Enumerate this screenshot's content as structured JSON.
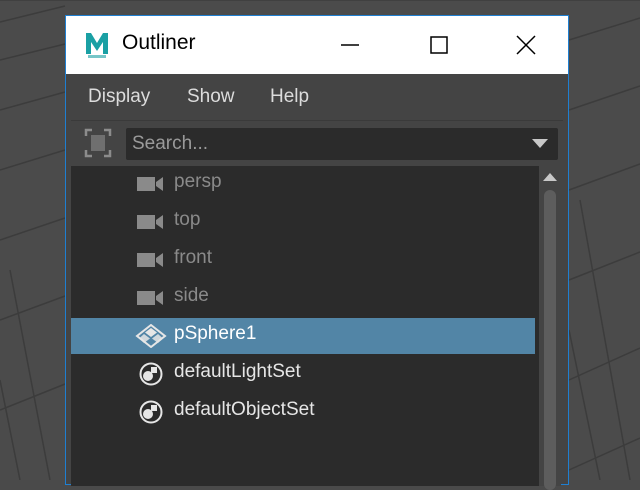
{
  "window": {
    "title": "Outliner",
    "border_color": "#1f7fd1"
  },
  "menu": {
    "items": [
      {
        "label": "Display"
      },
      {
        "label": "Show"
      },
      {
        "label": "Help"
      }
    ]
  },
  "search": {
    "placeholder": "Search..."
  },
  "outliner": {
    "items": [
      {
        "label": "persp",
        "icon": "camera-icon",
        "dimmed": true,
        "selected": false
      },
      {
        "label": "top",
        "icon": "camera-icon",
        "dimmed": true,
        "selected": false
      },
      {
        "label": "front",
        "icon": "camera-icon",
        "dimmed": true,
        "selected": false
      },
      {
        "label": "side",
        "icon": "camera-icon",
        "dimmed": true,
        "selected": false
      },
      {
        "label": "pSphere1",
        "icon": "transform-icon",
        "dimmed": false,
        "selected": true
      },
      {
        "label": "defaultLightSet",
        "icon": "set-icon",
        "dimmed": false,
        "selected": false
      },
      {
        "label": "defaultObjectSet",
        "icon": "set-icon",
        "dimmed": false,
        "selected": false
      }
    ]
  },
  "colors": {
    "selection": "#5285a6",
    "dimmed_text": "#8a8a8a",
    "normal_text": "#e6e6e6"
  }
}
